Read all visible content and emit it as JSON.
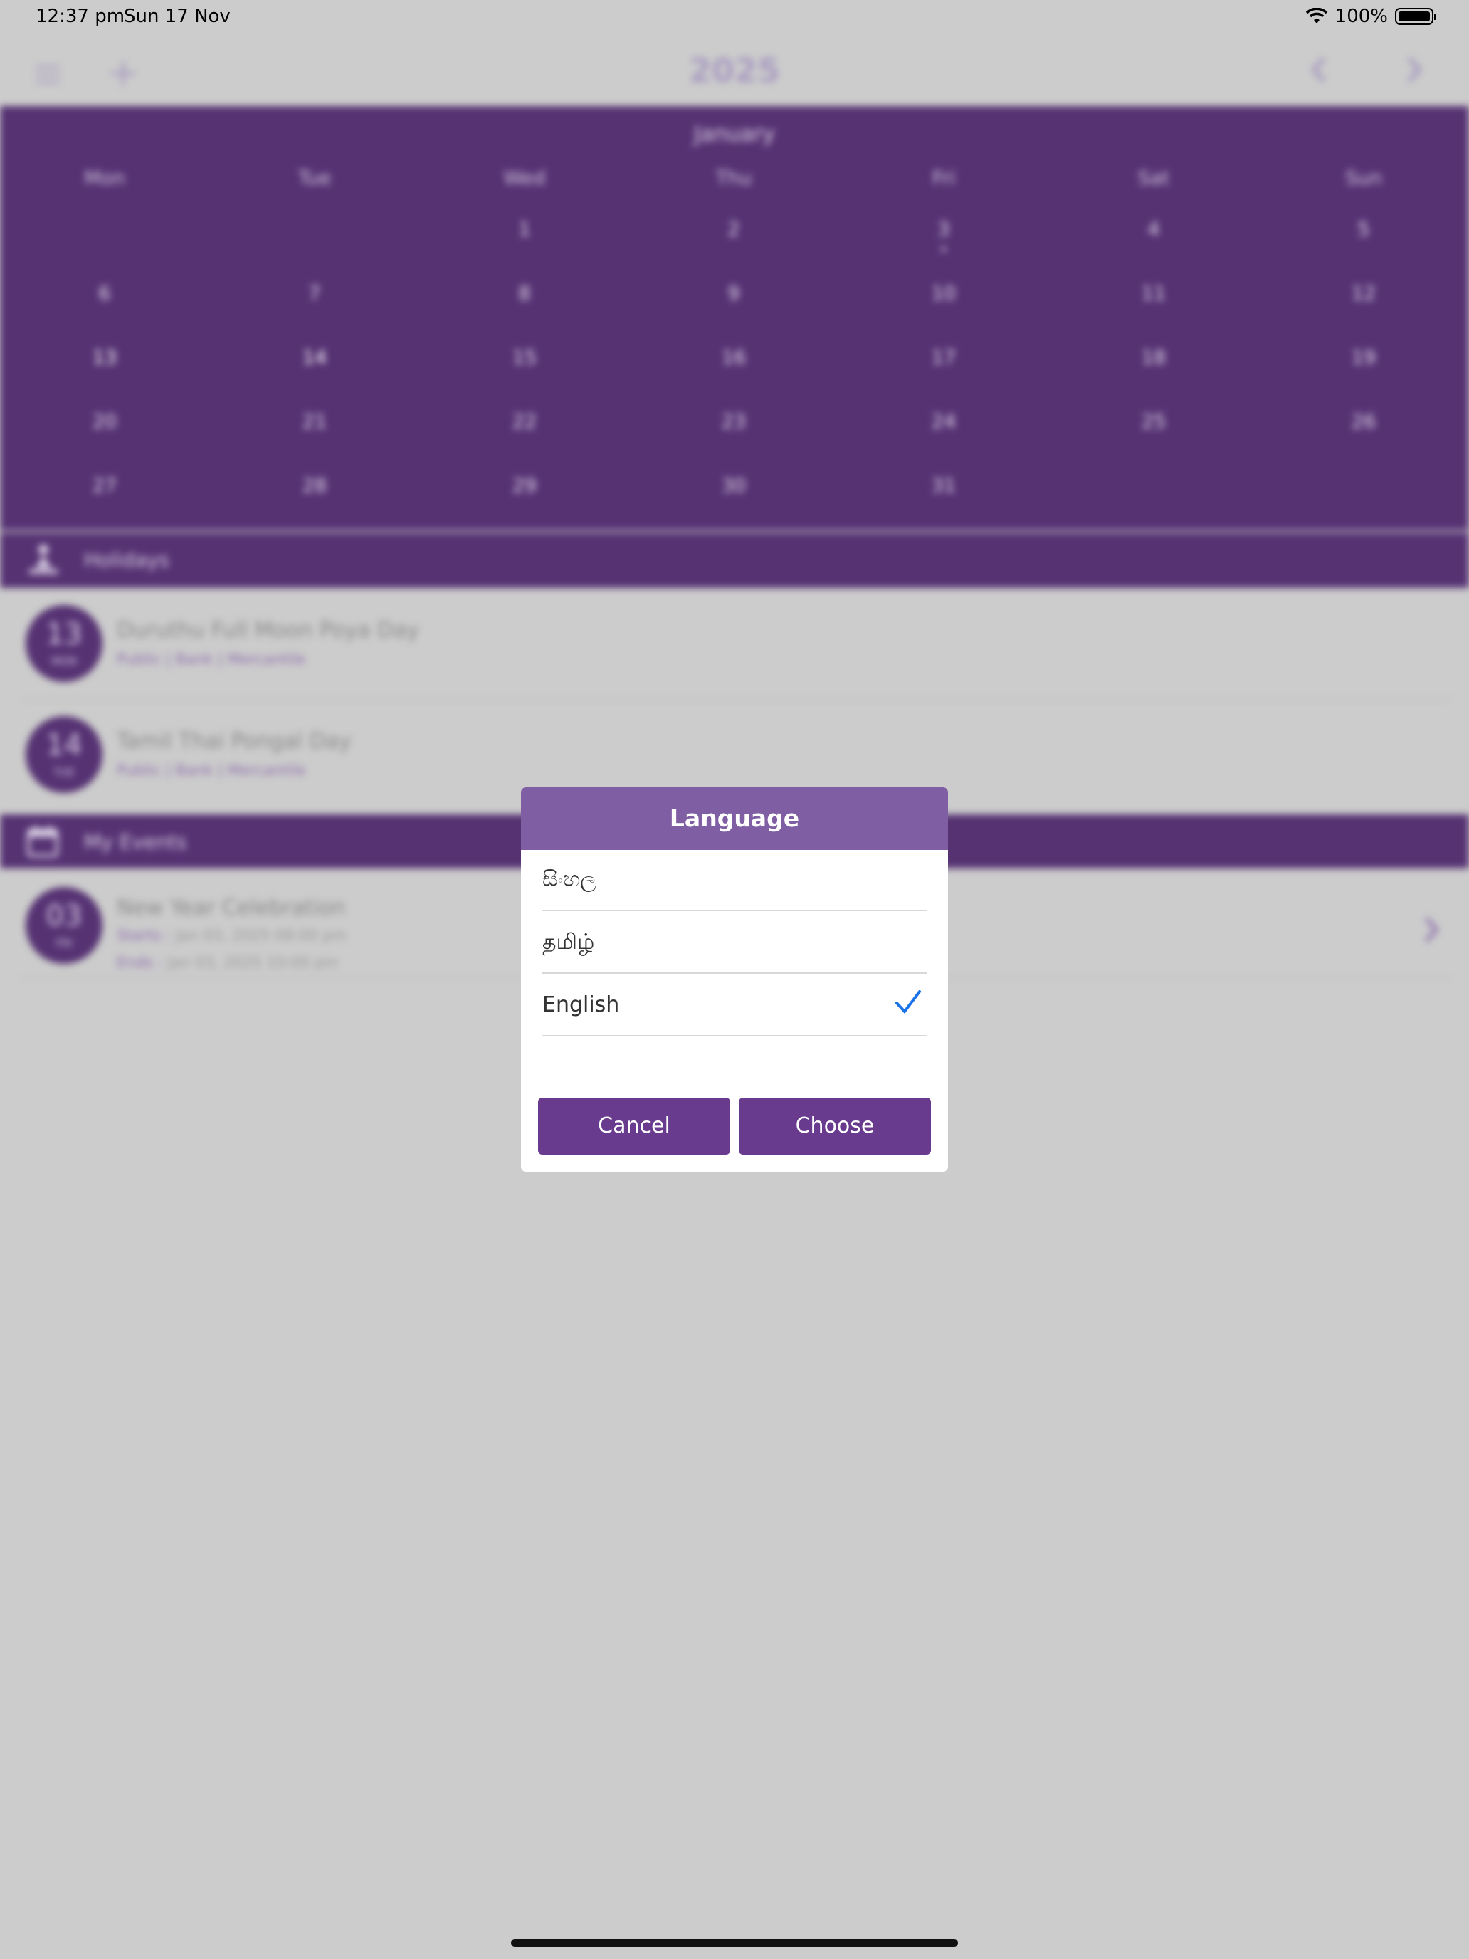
{
  "status_bar": {
    "time": "12:37 pm",
    "date": "Sun 17 Nov",
    "battery": "100%"
  },
  "header": {
    "year": "2025"
  },
  "calendar": {
    "month": "January",
    "weekdays": [
      "Mon",
      "Tue",
      "Wed",
      "Thu",
      "Fri",
      "Sat",
      "Sun"
    ],
    "days": [
      "1",
      "2",
      "3",
      "4",
      "5",
      "6",
      "7",
      "8",
      "9",
      "10",
      "11",
      "12",
      "13",
      "14",
      "15",
      "16",
      "17",
      "18",
      "19",
      "20",
      "21",
      "22",
      "23",
      "24",
      "25",
      "26",
      "27",
      "28",
      "29",
      "30",
      "31"
    ],
    "marked_days": [
      "13",
      "14"
    ],
    "event_days": [
      "3"
    ]
  },
  "holidays": {
    "label": "Holidays",
    "items": [
      {
        "day": "13",
        "month": "MON",
        "title": "Duruthu Full Moon Poya Day",
        "tags": "Public | Bank | Mercantile"
      },
      {
        "day": "14",
        "month": "TUE",
        "title": "Tamil Thai Pongal Day",
        "tags": "Public | Bank | Mercantile"
      }
    ]
  },
  "my_events": {
    "label": "My Events",
    "items": [
      {
        "day": "03",
        "month": "FRI",
        "title": "New Year Celebration",
        "starts_label": "Starts :",
        "starts": "Jan 03, 2025 08:00 pm",
        "ends_label": "Ends :",
        "ends": "Jan 03, 2025 10:00 pm"
      }
    ]
  },
  "dialog": {
    "title": "Language",
    "options": [
      {
        "label": "සිංහල",
        "selected": false
      },
      {
        "label": "தமிழ்",
        "selected": false
      },
      {
        "label": "English",
        "selected": true
      }
    ],
    "cancel_label": "Cancel",
    "choose_label": "Choose"
  },
  "colors": {
    "primary": "#563273",
    "dialog_header": "#7f5ea3",
    "button": "#693b8f",
    "check": "#1a73e8",
    "marked_day": "#d9305e"
  }
}
